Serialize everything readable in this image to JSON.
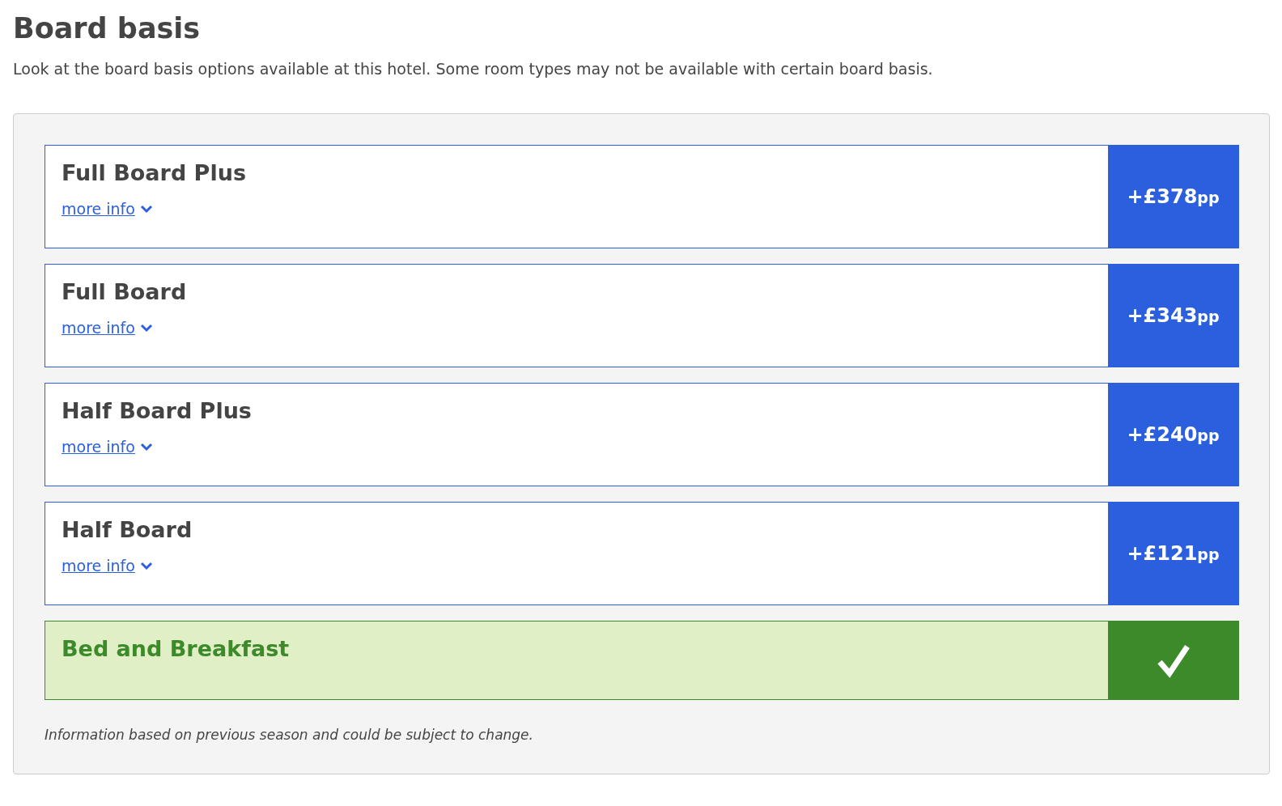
{
  "title": "Board basis",
  "description": "Look at the board basis options available at this hotel. Some room types may not be available with certain board basis.",
  "options": [
    {
      "name": "Full Board Plus",
      "link": "more info",
      "price": "+£378",
      "unit": "pp",
      "selected": false
    },
    {
      "name": "Full Board",
      "link": "more info",
      "price": "+£343",
      "unit": "pp",
      "selected": false
    },
    {
      "name": "Half Board Plus",
      "link": "more info",
      "price": "+£240",
      "unit": "pp",
      "selected": false
    },
    {
      "name": "Half Board",
      "link": "more info",
      "price": "+£121",
      "unit": "pp",
      "selected": false
    },
    {
      "name": "Bed and Breakfast",
      "selected": true
    }
  ],
  "note": "Information based on previous season and could be subject to change."
}
